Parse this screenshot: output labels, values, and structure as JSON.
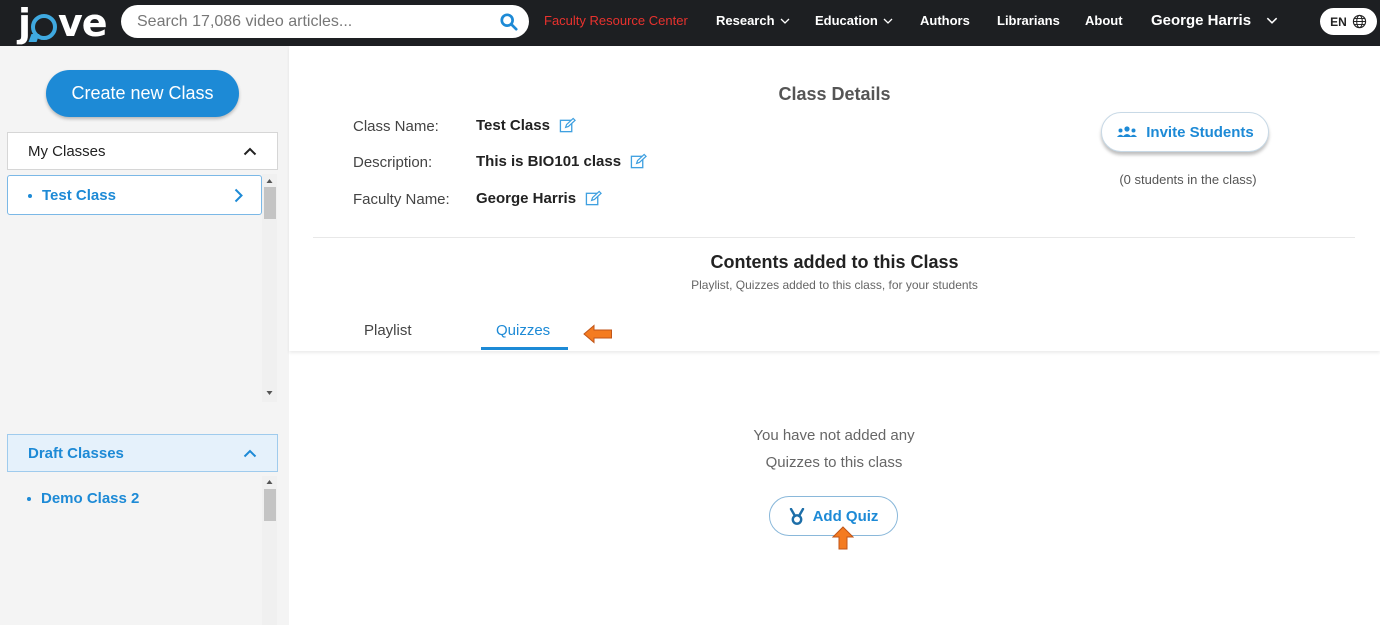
{
  "topbar": {
    "logo_left": "j",
    "logo_right": "ve",
    "search_placeholder": "Search 17,086 video articles...",
    "faculty_resource_center": "Faculty Resource Center",
    "nav": [
      "Research",
      "Education",
      "Authors",
      "Librarians",
      "About"
    ],
    "user_name": "George Harris",
    "language": "EN"
  },
  "sidebar": {
    "create_button": "Create new Class",
    "my_classes_label": "My Classes",
    "my_classes": [
      "Test Class"
    ],
    "draft_classes_label": "Draft Classes",
    "draft_classes": [
      "Demo Class 2"
    ]
  },
  "details": {
    "title": "Class Details",
    "class_name_label": "Class Name:",
    "class_name": "Test Class",
    "description_label": "Description:",
    "description": "This is BIO101 class",
    "faculty_label": "Faculty Name:",
    "faculty_name": "George Harris",
    "invite_button": "Invite Students",
    "students_count": "(0 students in the class)"
  },
  "contents": {
    "title": "Contents added to this Class",
    "subtitle": "Playlist, Quizzes added to this class, for your students",
    "tabs": [
      "Playlist",
      "Quizzes"
    ],
    "active_tab": "Quizzes",
    "empty_line1": "You have not added any",
    "empty_line2": "Quizzes to this class",
    "add_button": "Add Quiz"
  },
  "colors": {
    "accent": "#1d8ad6",
    "topbar": "#1d1f22",
    "highlight_red": "#e8322e",
    "annotation_arrow": "#f47b20"
  },
  "icons": [
    "search-icon",
    "chevron-down-icon",
    "globe-icon",
    "chevron-up-icon",
    "chevron-right-icon",
    "edit-icon",
    "users-icon",
    "medal-icon",
    "arrow-annotation-icon"
  ]
}
